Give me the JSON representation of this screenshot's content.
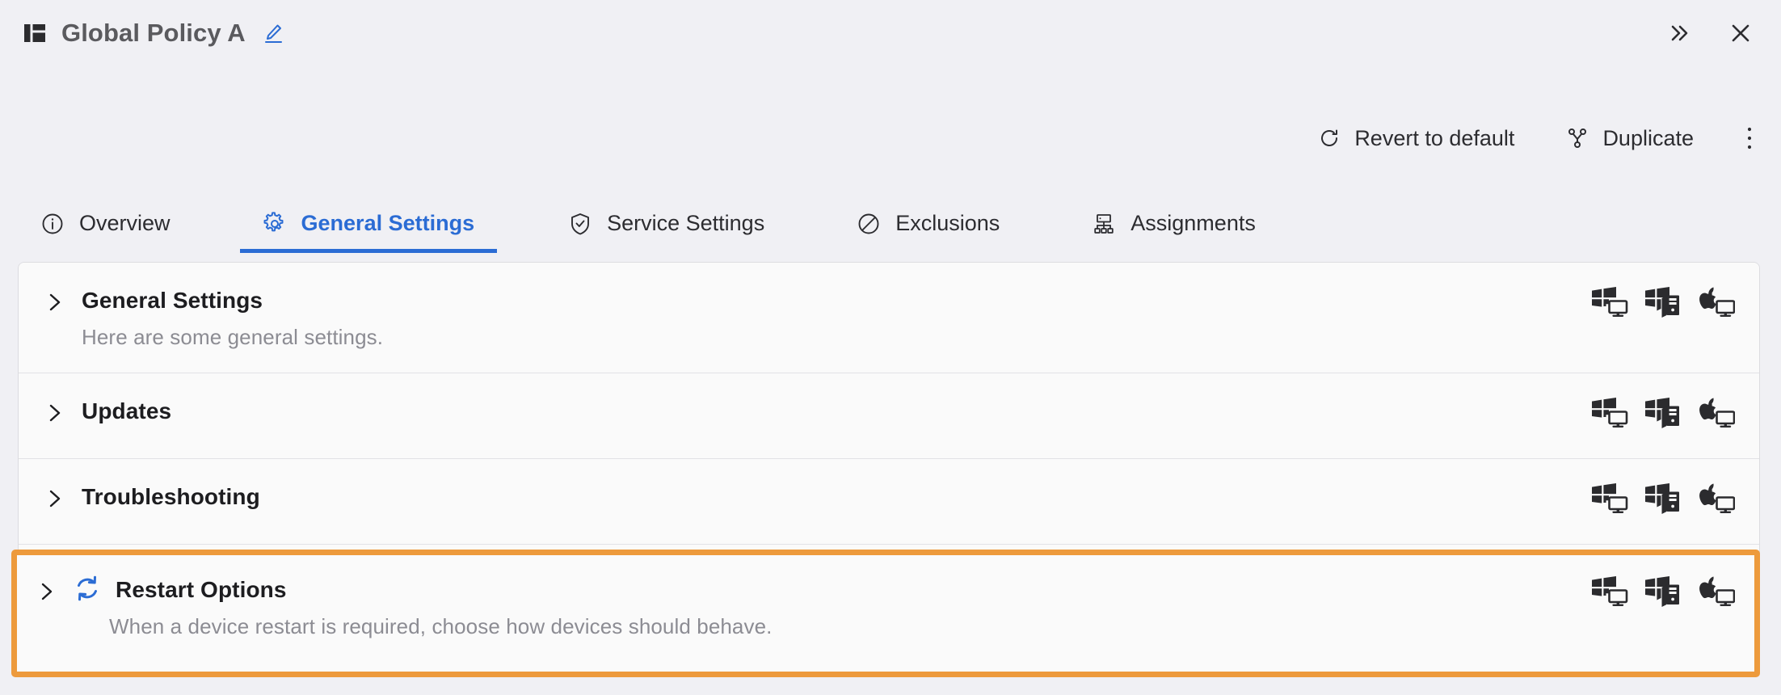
{
  "window": {
    "title": "Global Policy A",
    "panel_icon": "layout-panel-icon",
    "edit_icon": "pencil-edit-icon",
    "expand_icon": "double-chevron-right-icon",
    "close_icon": "close-x-icon"
  },
  "toolbar": {
    "revert": {
      "label": "Revert to default",
      "icon": "refresh-circular-icon"
    },
    "duplicate": {
      "label": "Duplicate",
      "icon": "branch-fork-icon"
    },
    "more": {
      "icon": "kebab-more-vertical-icon"
    }
  },
  "tabs": [
    {
      "label": "Overview",
      "icon": "info-circle-icon",
      "active": false
    },
    {
      "label": "General Settings",
      "icon": "gear-icon",
      "active": true
    },
    {
      "label": "Service Settings",
      "icon": "shield-check-icon",
      "active": false
    },
    {
      "label": "Exclusions",
      "icon": "block-slash-icon",
      "active": false
    },
    {
      "label": "Assignments",
      "icon": "hierarchy-icon",
      "active": false
    }
  ],
  "platform_icons": [
    "windows-workstation-icon",
    "windows-server-icon",
    "apple-mac-icon"
  ],
  "sections": [
    {
      "title": "General Settings",
      "description": "Here are some general settings.",
      "chevron": "chevron-right-icon",
      "highlighted": false
    },
    {
      "title": "Updates",
      "description": "",
      "chevron": "chevron-right-icon",
      "highlighted": false
    },
    {
      "title": "Troubleshooting",
      "description": "",
      "chevron": "chevron-right-icon",
      "highlighted": false
    },
    {
      "title": "Restart Options",
      "description": "When a device restart is required, choose how devices should behave.",
      "chevron": "chevron-right-icon",
      "leading_icon": "restart-circular-arrows-icon",
      "highlighted": true
    }
  ],
  "colors": {
    "page_background": "#f0f0f4",
    "card_background": "#fafafa",
    "accent_blue": "#2b6cd4",
    "highlight_orange": "#ed9a3c",
    "text_primary": "#1d1d20",
    "text_muted": "#8c8c93"
  }
}
